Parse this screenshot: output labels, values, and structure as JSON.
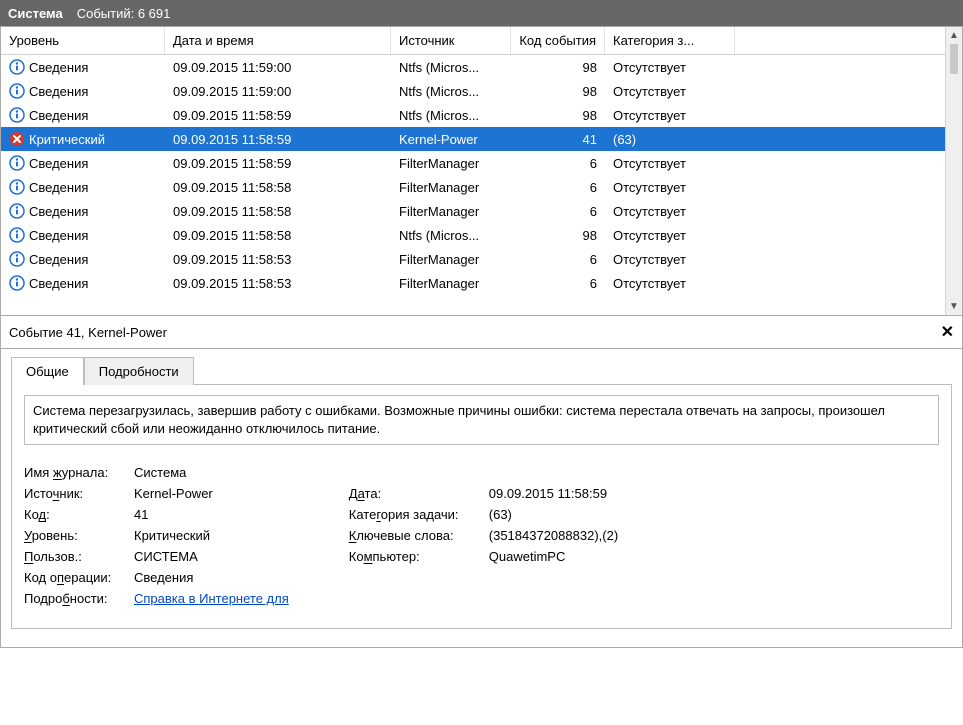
{
  "titlebar": {
    "title": "Система",
    "count_label": "Событий: 6 691"
  },
  "columns": {
    "level": "Уровень",
    "dateTime": "Дата и время",
    "source": "Источник",
    "code": "Код события",
    "category": "Категория з..."
  },
  "rows": [
    {
      "icon": "info",
      "level": "Сведения",
      "date": "09.09.2015 11:59:00",
      "source": "Ntfs (Micros...",
      "code": "98",
      "cat": "Отсутствует",
      "sel": false
    },
    {
      "icon": "info",
      "level": "Сведения",
      "date": "09.09.2015 11:59:00",
      "source": "Ntfs (Micros...",
      "code": "98",
      "cat": "Отсутствует",
      "sel": false
    },
    {
      "icon": "info",
      "level": "Сведения",
      "date": "09.09.2015 11:58:59",
      "source": "Ntfs (Micros...",
      "code": "98",
      "cat": "Отсутствует",
      "sel": false
    },
    {
      "icon": "crit",
      "level": "Критический",
      "date": "09.09.2015 11:58:59",
      "source": "Kernel-Power",
      "code": "41",
      "cat": "(63)",
      "sel": true
    },
    {
      "icon": "info",
      "level": "Сведения",
      "date": "09.09.2015 11:58:59",
      "source": "FilterManager",
      "code": "6",
      "cat": "Отсутствует",
      "sel": false
    },
    {
      "icon": "info",
      "level": "Сведения",
      "date": "09.09.2015 11:58:58",
      "source": "FilterManager",
      "code": "6",
      "cat": "Отсутствует",
      "sel": false
    },
    {
      "icon": "info",
      "level": "Сведения",
      "date": "09.09.2015 11:58:58",
      "source": "FilterManager",
      "code": "6",
      "cat": "Отсутствует",
      "sel": false
    },
    {
      "icon": "info",
      "level": "Сведения",
      "date": "09.09.2015 11:58:58",
      "source": "Ntfs (Micros...",
      "code": "98",
      "cat": "Отсутствует",
      "sel": false
    },
    {
      "icon": "info",
      "level": "Сведения",
      "date": "09.09.2015 11:58:53",
      "source": "FilterManager",
      "code": "6",
      "cat": "Отсутствует",
      "sel": false
    },
    {
      "icon": "info",
      "level": "Сведения",
      "date": "09.09.2015 11:58:53",
      "source": "FilterManager",
      "code": "6",
      "cat": "Отсутствует",
      "sel": false
    }
  ],
  "detail": {
    "header": "Событие 41, Kernel-Power",
    "tabs": {
      "general": "Общие",
      "details": "Подробности"
    },
    "message": "Система перезагрузилась, завершив работу с ошибками. Возможные причины ошибки: система перестала отвечать на запросы, произошел критический сбой или неожиданно отключилось питание.",
    "labels": {
      "logName": "Имя журнала:",
      "source": "Источник:",
      "code": "Код:",
      "level": "Уровень:",
      "user": "Пользов.:",
      "opcode": "Код операции:",
      "moreInfo": "Подробности:",
      "date": "Дата:",
      "taskCat": "Категория задачи:",
      "keywords": "Ключевые слова:",
      "computer": "Компьютер:"
    },
    "values": {
      "logName": "Система",
      "source": "Kernel-Power",
      "code": "41",
      "level": "Критический",
      "user": "СИСТЕМА",
      "opcode": "Сведения",
      "moreInfoLink": "Справка в Интернете для ",
      "date": "09.09.2015 11:58:59",
      "taskCat": "(63)",
      "keywords": "(35184372088832),(2)",
      "computer": "QuawetimPC"
    },
    "underlineHints": {
      "logName_u": "ж",
      "source_u": "ч",
      "code_u": "д",
      "level_u": "У",
      "user_u": "П",
      "opcode_u": "п",
      "moreInfo_u": "б",
      "date_u": "а",
      "taskCat_u": "г",
      "keywords_u": "К",
      "computer_u": "м"
    }
  },
  "icons": {
    "info": "info-icon",
    "crit": "critical-icon"
  }
}
